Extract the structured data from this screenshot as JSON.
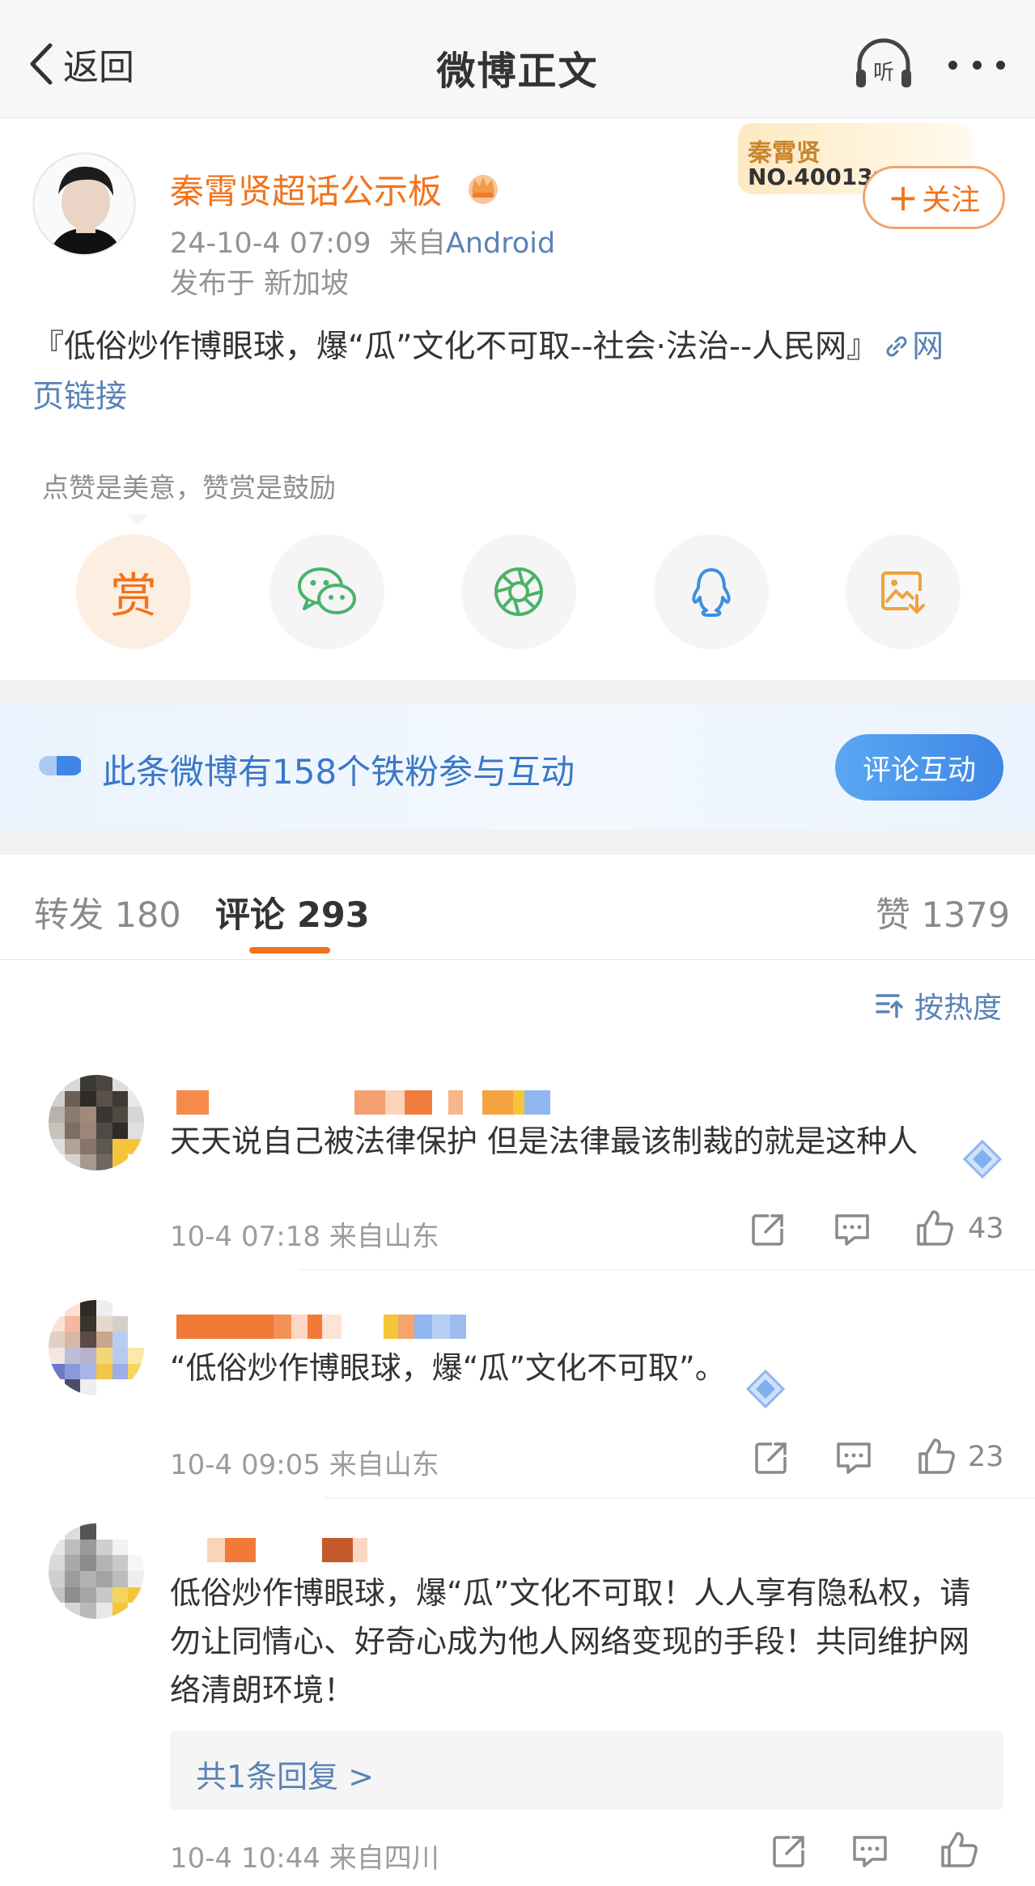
{
  "header": {
    "back_label": "返回",
    "title": "微博正文"
  },
  "post": {
    "username": "秦霄贤超话公示板",
    "time": "24-10-4 07:09",
    "source_prefix": "来自",
    "source": "Android",
    "location": "发布于 新加坡",
    "badge_name": "秦霄贤",
    "badge_no": "NO.400130",
    "follow_label": "关注",
    "text": "『低俗炒作博眼球，爆“瓜”文化不可取--社会·法治--人民网』",
    "link_line1": "网",
    "link_line2": "页链接",
    "reward_tip": "点赞是美意，赞赏是鼓励",
    "reward_label": "赏"
  },
  "fan_banner": {
    "text": "此条微博有158个铁粉参与互动",
    "button": "评论互动"
  },
  "tabs": {
    "repost": "转发 180",
    "comment": "评论 293",
    "like": "赞 1379"
  },
  "sort_label": "按热度",
  "comments": [
    {
      "text": "天天说自己被法律保护 但是法律最该制裁的就是这种人",
      "meta": "10-4 07:18 来自山东",
      "likes": "43"
    },
    {
      "text": "“低俗炒作博眼球，爆“瓜”文化不可取”。",
      "meta": "10-4 09:05 来自山东",
      "likes": "23"
    },
    {
      "text": "低俗炒作博眼球，爆“瓜”文化不可取！人人享有隐私权，请勿让同情心、好奇心成为他人网络变现的手段！共同维护网络清朗环境！",
      "meta": "10-4 10:44 来自四川",
      "reply_label": "共1条回复 >"
    }
  ],
  "colors": {
    "accent": "#f2731d",
    "link": "#5a83b6",
    "fan_blue": "#3a78c8"
  },
  "icons": [
    "back-chevron-icon",
    "listen-headphone-icon",
    "more-dots-icon",
    "crown-icon",
    "link-icon",
    "wechat-icon",
    "moments-icon",
    "qq-icon",
    "save-image-icon",
    "fans-icon",
    "sort-icon",
    "share-icon",
    "comment-icon",
    "like-icon",
    "gem-icon"
  ]
}
